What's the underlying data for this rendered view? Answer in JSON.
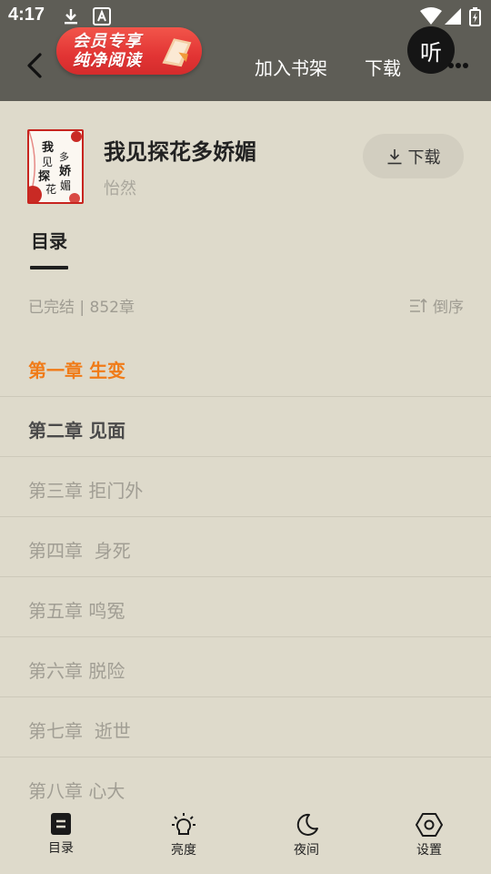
{
  "status_bar": {
    "time": "4:17"
  },
  "nav": {
    "vip_banner_line1": "会员专享",
    "vip_banner_line2": "纯净阅读",
    "add_to_shelf": "加入书架",
    "download": "下载",
    "listen": "听"
  },
  "book": {
    "title": "我见探花多娇媚",
    "author": "怡然",
    "download_label": "下载",
    "cover_text": "我见探花多娇媚"
  },
  "toc": {
    "tab_label": "目录",
    "status": "已完结 | 852章",
    "sort_label": "倒序",
    "chapters": [
      {
        "label": "第一章 生变",
        "state": "current"
      },
      {
        "label": "第二章 见面",
        "state": "read"
      },
      {
        "label": "第三章 拒门外",
        "state": "unread"
      },
      {
        "label": "第四章  身死",
        "state": "unread"
      },
      {
        "label": "第五章 鸣冤",
        "state": "unread"
      },
      {
        "label": "第六章 脱险",
        "state": "unread"
      },
      {
        "label": "第七章  逝世",
        "state": "unread"
      },
      {
        "label": "第八章 心大",
        "state": "unread"
      }
    ]
  },
  "bottom_bar": {
    "items": [
      {
        "label": "目录",
        "icon": "list-icon"
      },
      {
        "label": "亮度",
        "icon": "brightness-icon"
      },
      {
        "label": "夜间",
        "icon": "moon-icon"
      },
      {
        "label": "设置",
        "icon": "settings-hexagon-icon"
      }
    ]
  },
  "colors": {
    "background": "#dedacb",
    "topbar": "#5e5d56",
    "current_chapter": "#f07b18",
    "vip_red": "#e23434"
  }
}
